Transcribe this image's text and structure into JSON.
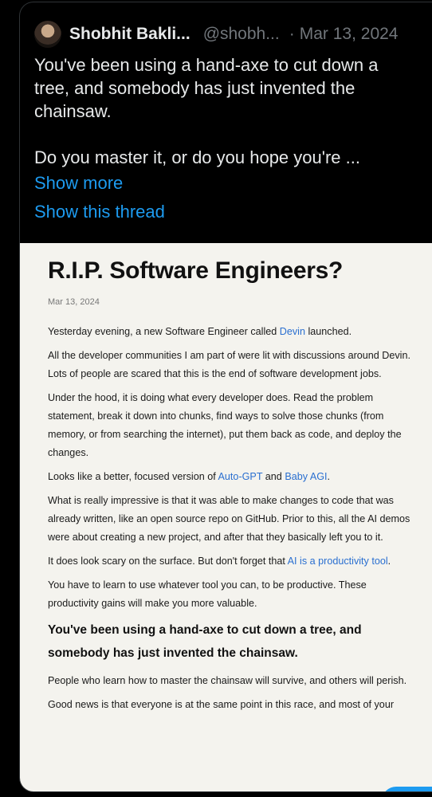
{
  "tweet": {
    "author_name": "Shobhit Bakli...",
    "author_handle": "@shobh...",
    "separator": "·",
    "date": "Mar 13, 2024",
    "paragraphs": [
      "You've been using a hand-axe to cut down a tree, and somebody has just invented the chainsaw.",
      "Do you master it, or do you hope you're ..."
    ],
    "show_more": "Show more",
    "show_thread": "Show this thread"
  },
  "article": {
    "title": "R.I.P. Software Engineers?",
    "date": "Mar 13, 2024",
    "p1_before": "Yesterday evening, a new Software Engineer called ",
    "p1_link": "Devin",
    "p1_after": " launched.",
    "p2": "All the developer communities I am part of were lit with discussions around Devin. Lots of people are scared that this is the end of software development jobs.",
    "p3": "Under the hood, it is doing what every developer does. Read the problem statement, break it down into chunks, find ways to solve those chunks (from memory, or from searching the internet), put them back as code, and deploy the changes.",
    "p4_before": "Looks like a better, focused version of ",
    "p4_link1": "Auto-GPT",
    "p4_mid": " and ",
    "p4_link2": "Baby AGI",
    "p4_after": ".",
    "p5": "What is really impressive is that it was able to make changes to code that was already written, like an open source repo on GitHub. Prior to this, all the AI demos were about creating a new project, and after that they basically left you to it.",
    "p6_before": "It does look scary on the surface. But don't forget that ",
    "p6_link": "AI is a productivity tool",
    "p6_after": ".",
    "p7": "You have to learn to use whatever tool you can, to be productive. These productivity gains will make you more valuable.",
    "heading": "You've been using a hand-axe to cut down a tree, and somebody has just invented the chainsaw.",
    "p8": "People who learn how to master the chainsaw will survive, and others will perish.",
    "p9": "Good news is that everyone is at the same point in this race, and most of your"
  }
}
